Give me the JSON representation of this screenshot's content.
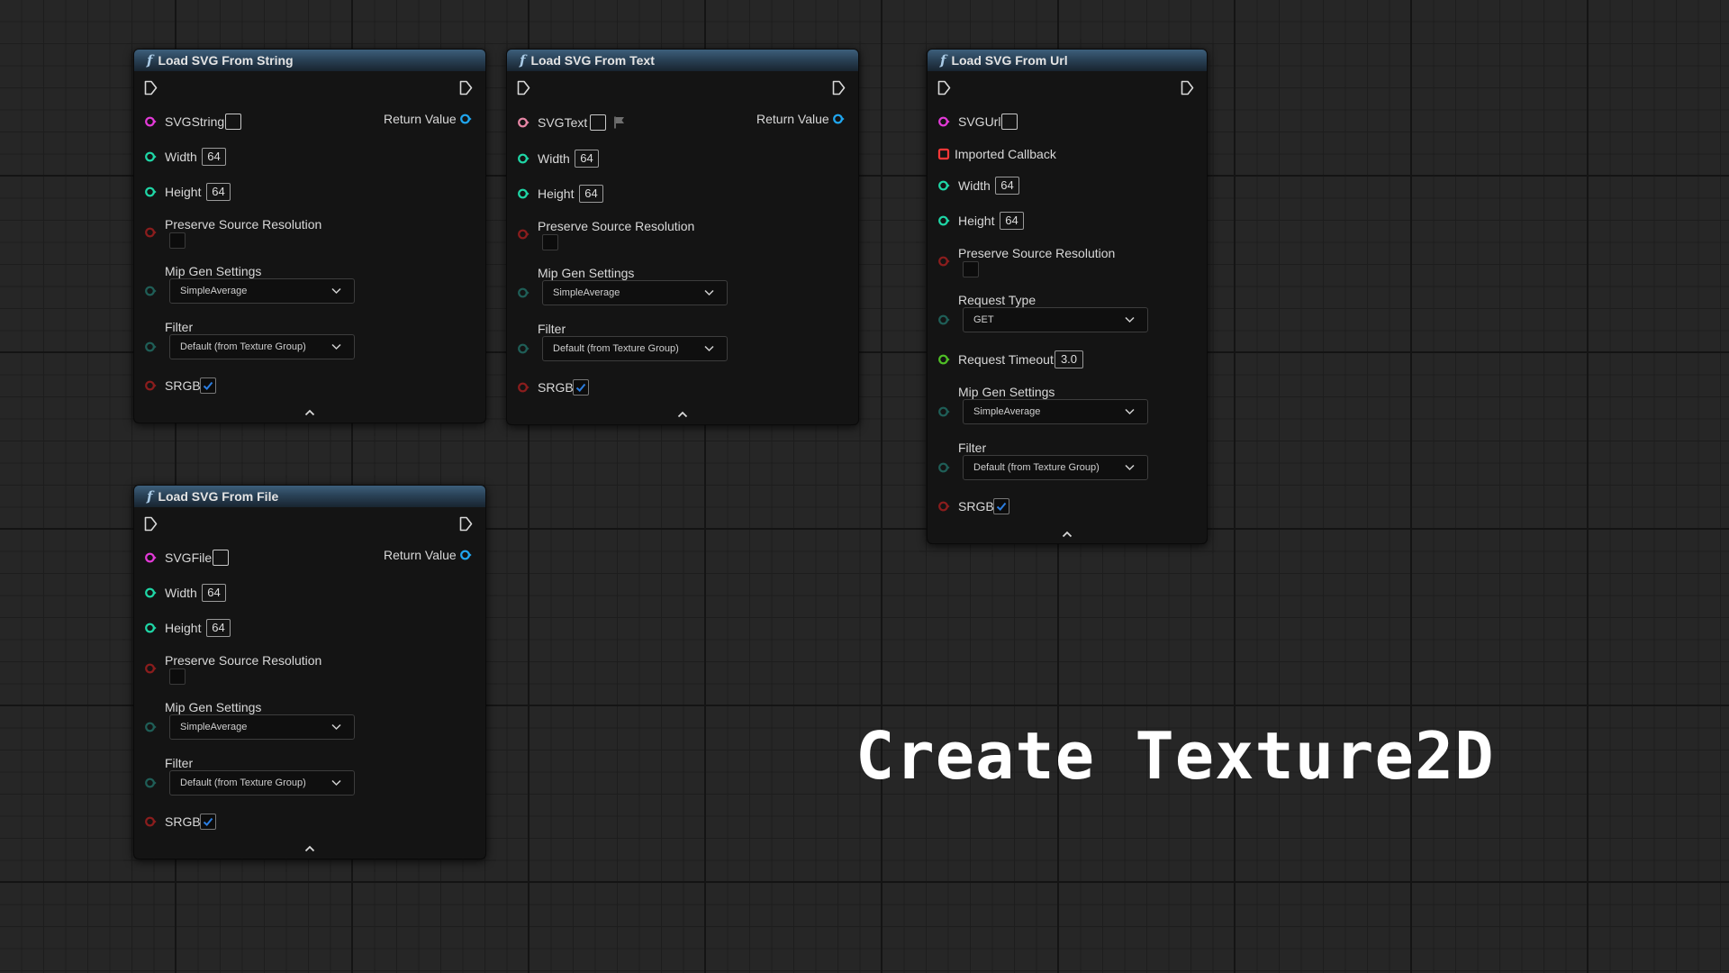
{
  "nodes": {
    "from_string": {
      "title": "Load SVG From String",
      "input_label": "SVGString",
      "return_label": "Return Value",
      "width_label": "Width",
      "width_value": "64",
      "height_label": "Height",
      "height_value": "64",
      "preserve_label": "Preserve Source Resolution",
      "mip_label": "Mip Gen Settings",
      "mip_value": "SimpleAverage",
      "filter_label": "Filter",
      "filter_value": "Default (from Texture Group)",
      "srgb_label": "SRGB"
    },
    "from_text": {
      "title": "Load SVG From Text",
      "input_label": "SVGText",
      "return_label": "Return Value",
      "width_label": "Width",
      "width_value": "64",
      "height_label": "Height",
      "height_value": "64",
      "preserve_label": "Preserve Source Resolution",
      "mip_label": "Mip Gen Settings",
      "mip_value": "SimpleAverage",
      "filter_label": "Filter",
      "filter_value": "Default (from Texture Group)",
      "srgb_label": "SRGB"
    },
    "from_url": {
      "title": "Load SVG From Url",
      "input_label": "SVGUrl",
      "callback_label": "Imported Callback",
      "width_label": "Width",
      "width_value": "64",
      "height_label": "Height",
      "height_value": "64",
      "preserve_label": "Preserve Source Resolution",
      "request_type_label": "Request Type",
      "request_type_value": "GET",
      "timeout_label": "Request Timeout",
      "timeout_value": "3.0",
      "mip_label": "Mip Gen Settings",
      "mip_value": "SimpleAverage",
      "filter_label": "Filter",
      "filter_value": "Default (from Texture Group)",
      "srgb_label": "SRGB"
    },
    "from_file": {
      "title": "Load SVG From File",
      "input_label": "SVGFile",
      "return_label": "Return Value",
      "width_label": "Width",
      "width_value": "64",
      "height_label": "Height",
      "height_value": "64",
      "preserve_label": "Preserve Source Resolution",
      "mip_label": "Mip Gen Settings",
      "mip_value": "SimpleAverage",
      "filter_label": "Filter",
      "filter_value": "Default (from Texture Group)",
      "srgb_label": "SRGB"
    }
  },
  "comment_text": "Create Texture2D",
  "colors": {
    "string_pin": "#e33ad8",
    "text_pin": "#e787a6",
    "int_pin": "#1fd6a6",
    "bool_pin": "#8b1d1d",
    "struct_pin": "#1f5e57",
    "float_pin": "#4fbf26",
    "delegate_pin": "#ff3838",
    "object_pin": "#20a7f0",
    "exec_pin": "#d8d8d8",
    "header_blue": "#2a4257",
    "check_blue": "#2b7de0"
  }
}
